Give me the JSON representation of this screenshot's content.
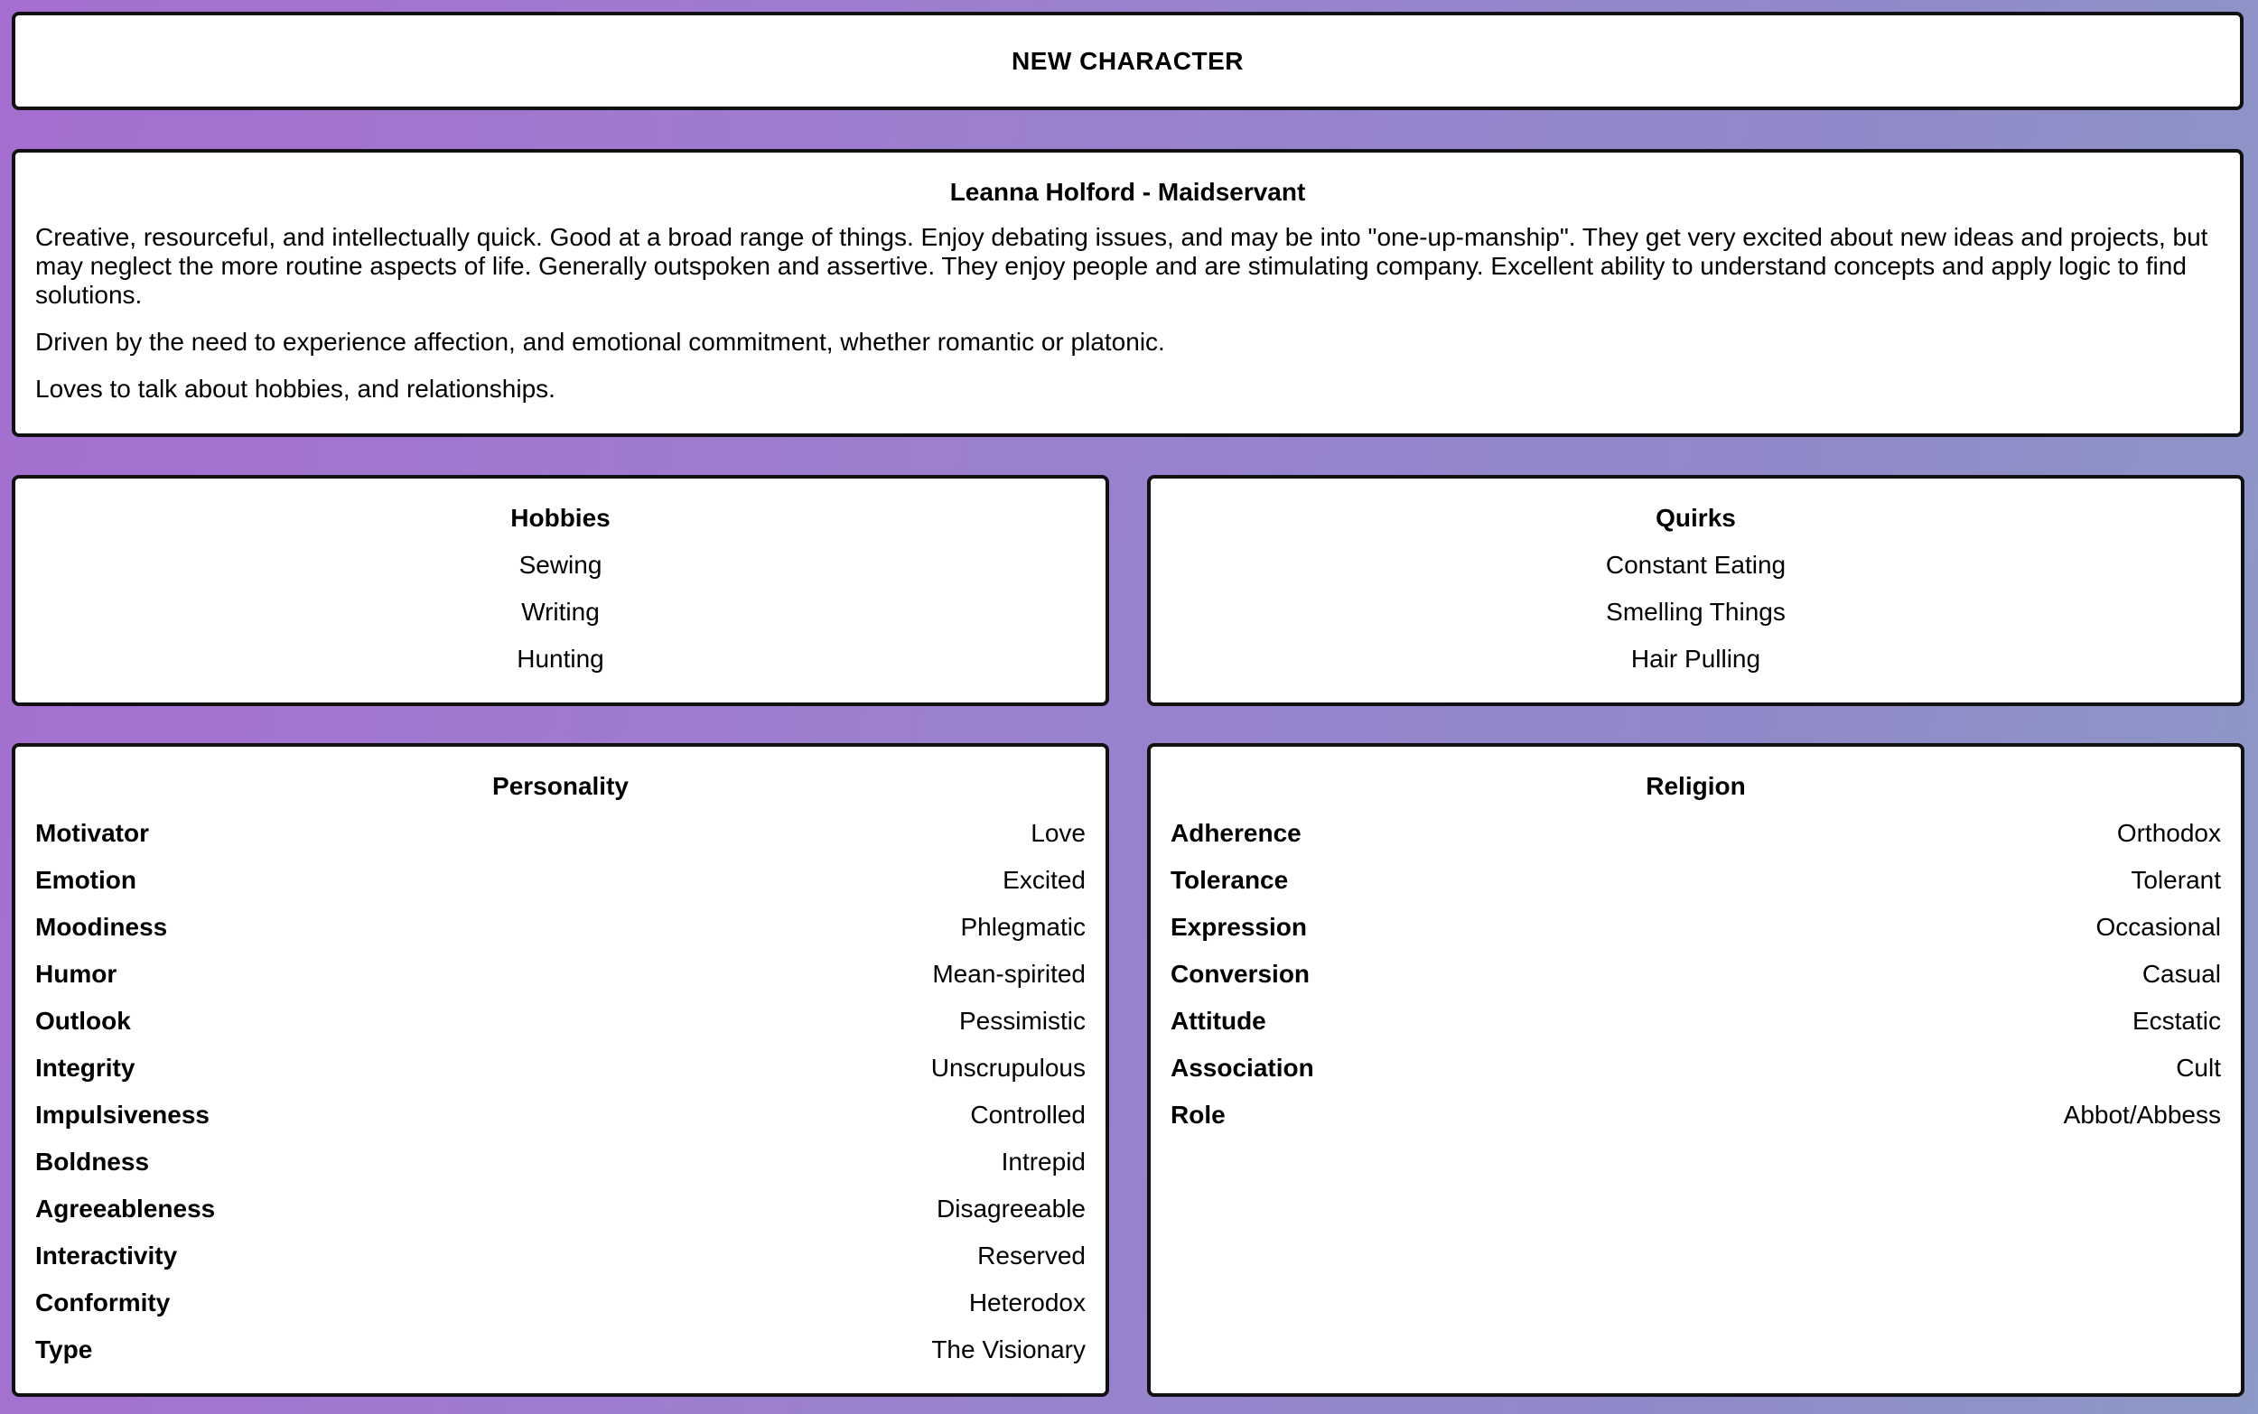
{
  "header": {
    "title": "NEW CHARACTER"
  },
  "bio": {
    "heading": "Leanna Holford - Maidservant",
    "paragraphs": [
      "Creative, resourceful, and intellectually quick. Good at a broad range of things. Enjoy debating issues, and may be into \"one-up-manship\". They get very excited about new ideas and projects, but may neglect the more routine aspects of life. Generally outspoken and assertive. They enjoy people and are stimulating company. Excellent ability to understand concepts and apply logic to find solutions.",
      "Driven by the need to experience affection, and emotional commitment, whether romantic or platonic.",
      "Loves to talk about hobbies, and relationships."
    ]
  },
  "hobbies": {
    "heading": "Hobbies",
    "items": [
      "Sewing",
      "Writing",
      "Hunting"
    ]
  },
  "quirks": {
    "heading": "Quirks",
    "items": [
      "Constant Eating",
      "Smelling Things",
      "Hair Pulling"
    ]
  },
  "personality": {
    "heading": "Personality",
    "rows": [
      {
        "name": "Motivator",
        "value": "Love"
      },
      {
        "name": "Emotion",
        "value": "Excited"
      },
      {
        "name": "Moodiness",
        "value": "Phlegmatic"
      },
      {
        "name": "Humor",
        "value": "Mean-spirited"
      },
      {
        "name": "Outlook",
        "value": "Pessimistic"
      },
      {
        "name": "Integrity",
        "value": "Unscrupulous"
      },
      {
        "name": "Impulsiveness",
        "value": "Controlled"
      },
      {
        "name": "Boldness",
        "value": "Intrepid"
      },
      {
        "name": "Agreeableness",
        "value": "Disagreeable"
      },
      {
        "name": "Interactivity",
        "value": "Reserved"
      },
      {
        "name": "Conformity",
        "value": "Heterodox"
      },
      {
        "name": "Type",
        "value": "The Visionary"
      }
    ]
  },
  "religion": {
    "heading": "Religion",
    "rows": [
      {
        "name": "Adherence",
        "value": "Orthodox"
      },
      {
        "name": "Tolerance",
        "value": "Tolerant"
      },
      {
        "name": "Expression",
        "value": "Occasional"
      },
      {
        "name": "Conversion",
        "value": "Casual"
      },
      {
        "name": "Attitude",
        "value": "Ecstatic"
      },
      {
        "name": "Association",
        "value": "Cult"
      },
      {
        "name": "Role",
        "value": "Abbot/Abbess"
      }
    ]
  }
}
